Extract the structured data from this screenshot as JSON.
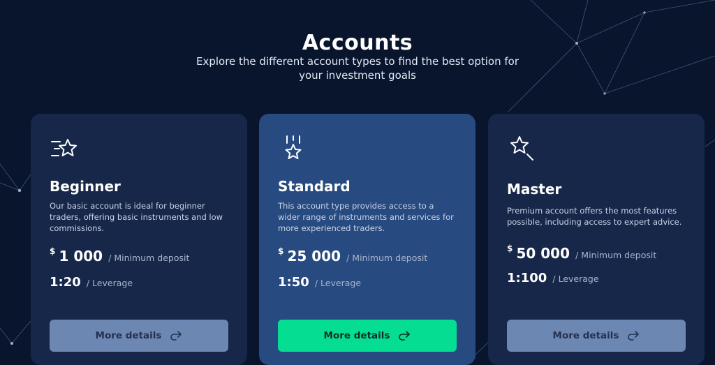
{
  "header": {
    "title": "Accounts",
    "subtitle": "Explore the different account types to find the best option for your investment goals"
  },
  "cards": [
    {
      "title": "Beginner",
      "icon": "star-list-icon",
      "description": "Our basic account is ideal for beginner traders, offering basic instruments and low commissions.",
      "currency": "$",
      "amount": "1 000",
      "amount_unit": "/ Minimum deposit",
      "leverage": "1:20",
      "leverage_unit": "/ Leverage",
      "button_label": "More details"
    },
    {
      "title": "Standard",
      "icon": "falling-star-icon",
      "description": "This account type provides access to a wider range of instruments and services for more experienced traders.",
      "currency": "$",
      "amount": "25 000",
      "amount_unit": "/ Minimum deposit",
      "leverage": "1:50",
      "leverage_unit": "/ Leverage",
      "button_label": "More details"
    },
    {
      "title": "Master",
      "icon": "magic-star-icon",
      "description": "Premium account offers the most features possible, including access to expert advice.",
      "currency": "$",
      "amount": "50 000",
      "amount_unit": "/ Minimum deposit",
      "leverage": "1:100",
      "leverage_unit": "/ Leverage",
      "button_label": "More details"
    }
  ],
  "colors": {
    "background": "#08152d",
    "card": "#17274a",
    "card_featured": "#274a80",
    "button": "#6d87b3",
    "button_primary": "#05de92"
  }
}
